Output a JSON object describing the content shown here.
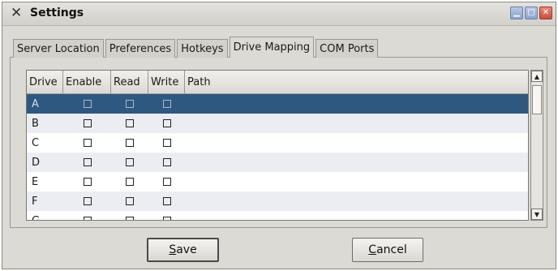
{
  "window": {
    "title": "Settings"
  },
  "tabs": [
    {
      "label": "Server Location",
      "active": false
    },
    {
      "label": "Preferences",
      "active": false
    },
    {
      "label": "Hotkeys",
      "active": false
    },
    {
      "label": "Drive Mapping",
      "active": true
    },
    {
      "label": "COM Ports",
      "active": false
    }
  ],
  "table": {
    "columns": [
      "Drive",
      "Enable",
      "Read",
      "Write",
      "Path"
    ],
    "rows": [
      {
        "drive": "A",
        "enable": false,
        "read": false,
        "write": false,
        "path": "",
        "selected": true
      },
      {
        "drive": "B",
        "enable": false,
        "read": false,
        "write": false,
        "path": ""
      },
      {
        "drive": "C",
        "enable": false,
        "read": false,
        "write": false,
        "path": ""
      },
      {
        "drive": "D",
        "enable": false,
        "read": false,
        "write": false,
        "path": ""
      },
      {
        "drive": "E",
        "enable": false,
        "read": false,
        "write": false,
        "path": ""
      },
      {
        "drive": "F",
        "enable": false,
        "read": false,
        "write": false,
        "path": ""
      },
      {
        "drive": "G",
        "enable": false,
        "read": false,
        "write": false,
        "path": ""
      }
    ]
  },
  "buttons": {
    "save": {
      "mnemonic": "S",
      "rest": "ave"
    },
    "cancel": {
      "mnemonic": "C",
      "rest": "ancel"
    }
  },
  "colors": {
    "selection": "#2f5880",
    "window_bg": "#dcdad5"
  }
}
